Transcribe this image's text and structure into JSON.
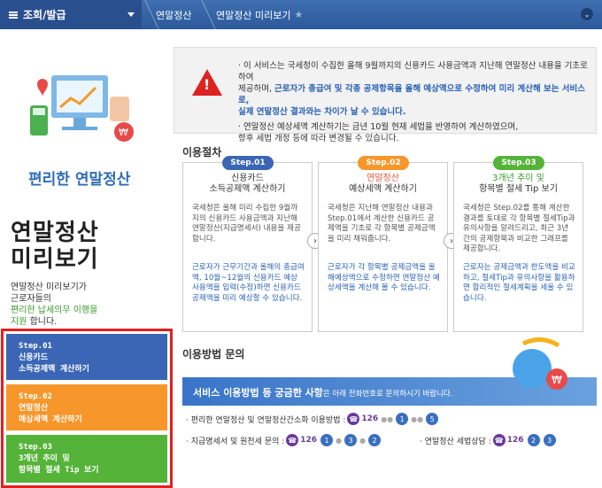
{
  "nav": {
    "menu": "조회/발급",
    "crumb1": "연말정산",
    "crumb2": "연말정산 미리보기",
    "star": "★",
    "toggle": "⌄"
  },
  "left": {
    "brand": "편리한 연말정산",
    "title1": "연말정산",
    "title2": "미리보기",
    "desc1": "연말정산 미리보기가",
    "desc2": "근로자들의",
    "desc3": "편리한 납세의무 이행을",
    "desc4a": "지원",
    "desc4b": " 합니다.",
    "steps": [
      {
        "line1": "Step.01",
        "line2": "신용카드",
        "line3": "소득공제액 계산하기"
      },
      {
        "line1": "Step.02",
        "line2": "연말정산",
        "line3": "예상세액 계산하기"
      },
      {
        "line1": "Step.03",
        "line2": "3개년 추이 및",
        "line3": "항목별 절세 Tip 보기"
      }
    ]
  },
  "notice": {
    "l1": "· 이 서비스는 국세청이 수집한 올해 9월까지의 신용카드 사용금액과 지난해 연말정산 내용을 기초로 하여",
    "l2a": "제공하며, ",
    "l2b": "근로자가 총급여 및 각종 공제항목을 올해 예상액으로 수정하여 미리 계산해 보는 서비스로,",
    "l3": "실제 연말정산 결과와는 차이가 날 수 있습니다.",
    "l4": "· 연말정산 예상세액 계산하기는 금년 10월 현재 세법을 반영하여 계산하였으며,",
    "l5": "향후 세법 개정 등에 따라 변경될 수 있습니다."
  },
  "procedure_title": "이용절차",
  "cards": [
    {
      "badge": "Step.01",
      "color": "#3b66b5",
      "t1": "신용카드",
      "t2": "소득공제액 계산하기",
      "p": "국세청은 올해 미리 수집한 9월까지의 신용카드 사용금액과 지난해 연말정산(지급명세서) 내용을 제공합니다.",
      "b": "근로자가 근무기간과 올해의 총급여액, 10월~12월의 신용카드 예상 사용액을 입력(수정)하면 신용카드 공제액을 미리 예상할 수 있습니다."
    },
    {
      "badge": "Step.02",
      "color": "#f7962a",
      "t1": "연말정산",
      "t2": "예상세액 계산하기",
      "p": "국세청은 지난해 연말정산 내용과 Step.01에서 계산한 신용카드 공제액을 기초로 각 항목별 공제금액을 미리 채워줍니다.",
      "b": "근로자가 각 항목별 공제금액을 올해예상액으로 수정하면 연말정산 예상세액을 계산해 볼 수 있습니다."
    },
    {
      "badge": "Step.03",
      "color": "#55b339",
      "t1": "3개년 추이 및",
      "t2": "항목별 절세 Tip 보기",
      "p": "국세청은 Step.02를 통해 계산한 결과를 토대로 각 항목별 절세Tip과 유의사항을 알려드리고, 최근 3년간의 공제항목과 비교한 그래프를 제공합니다.",
      "b": "근로자는 공제금액과 한도액을 비교하고, 절세Tip과 유의사항을 활용하면 합리적인 절세계획을 세울 수 있습니다."
    }
  ],
  "inquiry_title": "이용방법 문의",
  "qbanner": {
    "strong": "서비스 이용방법 등 궁금한 사항",
    "rest": "은 아래 전화번호로 문의하시기 바랍니다."
  },
  "contacts": [
    {
      "label": "· 편리한 연말정산 및 연말정산간소화 이용방법 :",
      "phone": "126",
      "nums": [
        "1",
        "5"
      ]
    },
    {
      "label": "· 지급명세서 및 원천세 문의 :",
      "phone": "126",
      "nums": [
        "1",
        "3",
        "2"
      ]
    },
    {
      "label": "· 연말정산 세법상담 :",
      "phone": "126",
      "nums": [
        "2",
        "3"
      ]
    }
  ]
}
